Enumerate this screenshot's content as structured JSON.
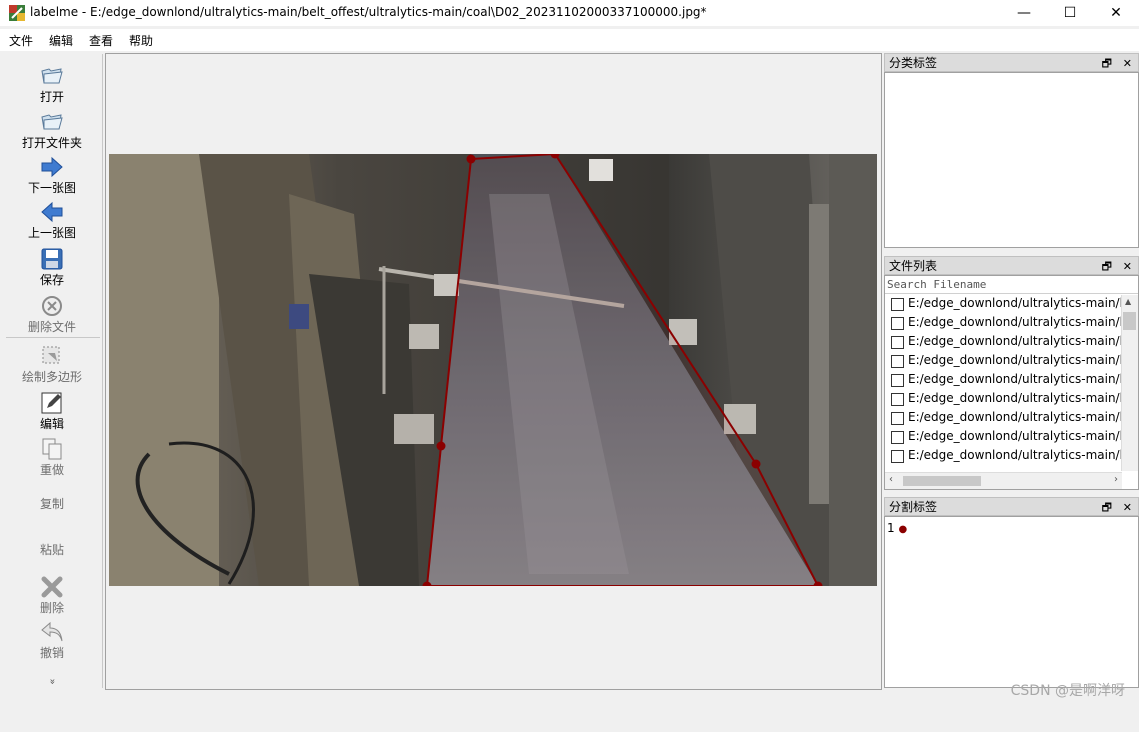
{
  "window": {
    "title": "labelme - E:/edge_downlond/ultralytics-main/belt_offest/ultralytics-main/coal\\D02_20231102000337100000.jpg*",
    "minimize": "—",
    "maximize": "☐",
    "close": "✕"
  },
  "menu": {
    "file": "文件",
    "edit": "编辑",
    "view": "查看",
    "help": "帮助"
  },
  "toolbar": {
    "open": "打开",
    "open_dir": "打开文件夹",
    "next": "下一张图",
    "prev": "上一张图",
    "save": "保存",
    "delete_file": "删除文件",
    "create_polygon": "绘制多边形",
    "edit": "编辑",
    "redo": "重做",
    "copy": "复制",
    "paste": "粘贴",
    "delete": "删除",
    "undo": "撤销",
    "more": "»"
  },
  "polygon": {
    "color": "#8b0000"
  },
  "docks": {
    "flags": {
      "title": "分类标签"
    },
    "files": {
      "title": "文件列表",
      "search_placeholder": "Search Filename",
      "items": [
        "E:/edge_downlond/ultralytics-main/b",
        "E:/edge_downlond/ultralytics-main/b",
        "E:/edge_downlond/ultralytics-main/b",
        "E:/edge_downlond/ultralytics-main/b",
        "E:/edge_downlond/ultralytics-main/b",
        "E:/edge_downlond/ultralytics-main/b",
        "E:/edge_downlond/ultralytics-main/b",
        "E:/edge_downlond/ultralytics-main/b",
        "E:/edge_downlond/ultralytics-main/b"
      ]
    },
    "labels": {
      "title": "分割标签",
      "items": [
        {
          "text": "1",
          "color": "#8b0000"
        }
      ]
    },
    "float_icon": "🗗",
    "close_icon": "✕"
  },
  "watermark": "CSDN @是啊洋呀"
}
